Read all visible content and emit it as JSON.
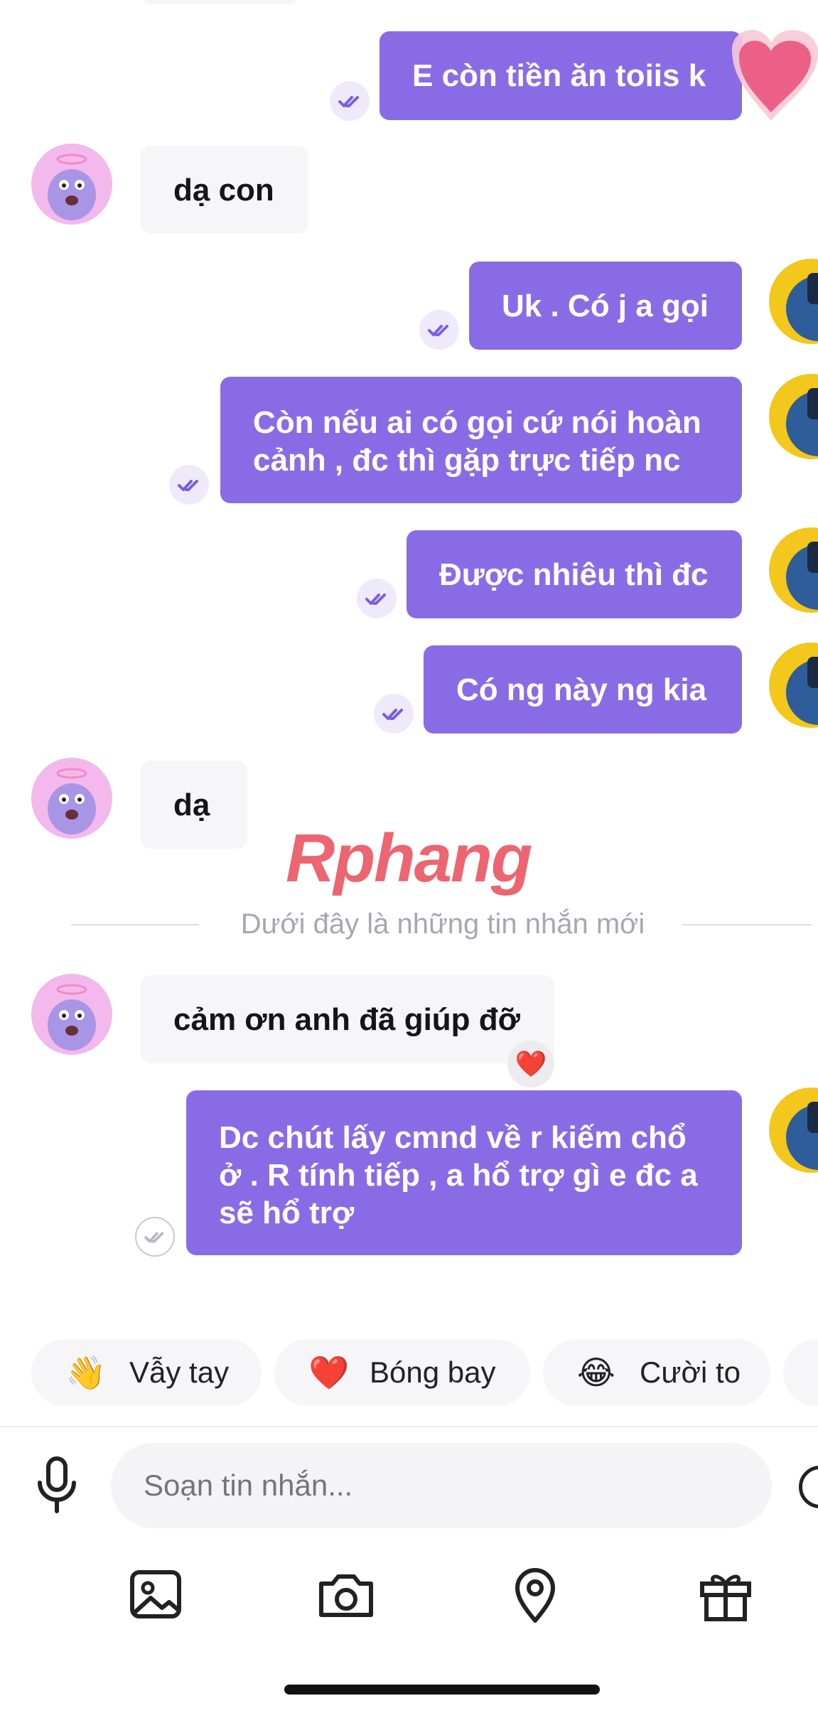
{
  "messages": [
    {
      "side": "out",
      "text": "E còn tiền ăn toiis k"
    },
    {
      "side": "in",
      "text": "dạ con"
    },
    {
      "side": "out",
      "text": "Uk . Có j a gọi"
    },
    {
      "side": "out",
      "text": "Còn nếu ai có gọi cứ nói hoàn cảnh , đc thì gặp trực tiếp nc"
    },
    {
      "side": "out",
      "text": "Được nhiêu thì đc"
    },
    {
      "side": "out",
      "text": "Có ng này ng kia"
    },
    {
      "side": "in",
      "text": "dạ"
    },
    {
      "side": "in",
      "text": "cảm ơn anh đã giúp đỡ",
      "reaction": "❤️"
    },
    {
      "side": "out",
      "text": "Dc chút lấy cmnd về r kiếm chổ ở . R tính tiếp , a hổ trợ gì e đc a sẽ hổ trợ"
    }
  ],
  "divider_text": "Dưới đây là những tin nhắn mới",
  "watermark": "Rphang",
  "quick_replies": [
    {
      "emoji": "👋",
      "label": "Vẫy tay"
    },
    {
      "emoji": "❤️",
      "label": "Bóng bay"
    },
    {
      "emoji": "😂",
      "label": "Cười to"
    }
  ],
  "composer": {
    "placeholder": "Soạn tin nhắn..."
  },
  "icons": {
    "mic": "microphone-icon",
    "emoji": "emoji-icon",
    "gallery": "image-icon",
    "camera": "camera-icon",
    "location": "location-pin-icon",
    "gift": "gift-icon",
    "seen": "double-check-icon"
  },
  "colors": {
    "accent": "#8a6be6",
    "incoming_bg": "#f6f6f8",
    "muted_text": "#a7a7b3"
  }
}
